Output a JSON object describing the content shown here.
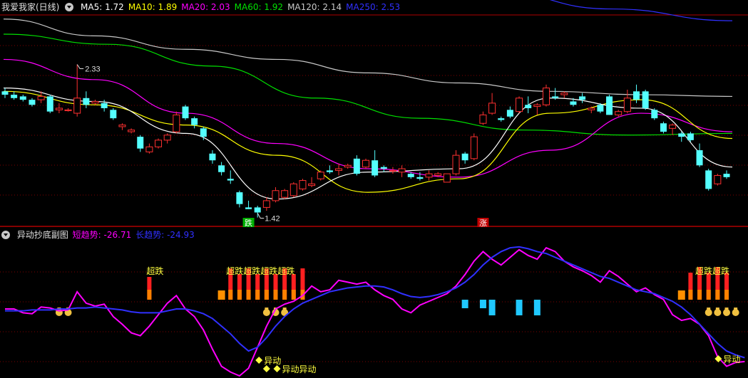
{
  "main_header": {
    "title": "我爱我家(日线)",
    "ma": [
      {
        "label": "MA5: 1.72",
        "color": "#ffffff"
      },
      {
        "label": "MA10: 1.89",
        "color": "#ffff00"
      },
      {
        "label": "MA20: 2.03",
        "color": "#ff00ff"
      },
      {
        "label": "MA60: 1.92",
        "color": "#00e000"
      },
      {
        "label": "MA120: 2.14",
        "color": "#c8c8c8"
      },
      {
        "label": "MA250: 2.53",
        "color": "#3030ff"
      }
    ]
  },
  "sub_header": {
    "title": "异动抄底副图",
    "items": [
      {
        "label": "短趋势: -26.71",
        "color": "#ff00ff"
      },
      {
        "label": "长趋势: -24.93",
        "color": "#3030ff"
      }
    ]
  },
  "chart_data": [
    {
      "type": "candlestick",
      "title": "我爱我家(日线)",
      "annotations": [
        {
          "text": "2.33",
          "kind": "high-marker"
        },
        {
          "text": "1.42",
          "kind": "low-marker"
        },
        {
          "text": "跌",
          "kind": "down-tag",
          "color": "#00b000"
        },
        {
          "text": "涨",
          "kind": "up-tag",
          "color": "#c00000"
        }
      ],
      "colors": {
        "up": "#ff3030",
        "down": "#54ffff",
        "grid": "#800000"
      },
      "ohlc": [
        [
          2.17,
          2.19,
          2.13,
          2.15
        ],
        [
          2.15,
          2.17,
          2.12,
          2.13
        ],
        [
          2.14,
          2.15,
          2.11,
          2.12
        ],
        [
          2.12,
          2.13,
          2.08,
          2.09
        ],
        [
          2.12,
          2.17,
          2.1,
          2.14
        ],
        [
          2.14,
          2.15,
          2.04,
          2.05
        ],
        [
          2.06,
          2.1,
          2.04,
          2.07
        ],
        [
          2.06,
          2.07,
          2.05,
          2.06
        ],
        [
          2.04,
          2.33,
          2.02,
          2.13
        ],
        [
          2.13,
          2.17,
          2.07,
          2.09
        ],
        [
          2.1,
          2.12,
          2.09,
          2.11
        ],
        [
          2.1,
          2.12,
          2.05,
          2.07
        ],
        [
          2.06,
          2.07,
          2.0,
          2.01
        ],
        [
          1.96,
          1.98,
          1.94,
          1.97
        ],
        [
          1.93,
          1.95,
          1.92,
          1.94
        ],
        [
          1.9,
          1.91,
          1.81,
          1.83
        ],
        [
          1.81,
          1.86,
          1.8,
          1.84
        ],
        [
          1.84,
          1.89,
          1.83,
          1.88
        ],
        [
          1.88,
          1.92,
          1.86,
          1.91
        ],
        [
          1.93,
          2.05,
          1.92,
          2.03
        ],
        [
          2.08,
          2.09,
          2.0,
          2.01
        ],
        [
          2.01,
          2.02,
          1.95,
          1.97
        ],
        [
          1.95,
          1.96,
          1.88,
          1.9
        ],
        [
          1.8,
          1.82,
          1.74,
          1.76
        ],
        [
          1.73,
          1.75,
          1.67,
          1.69
        ],
        [
          1.65,
          1.7,
          1.62,
          1.64
        ],
        [
          1.57,
          1.58,
          1.48,
          1.5
        ],
        [
          1.48,
          1.52,
          1.47,
          1.47
        ],
        [
          1.48,
          1.49,
          1.42,
          1.45
        ],
        [
          1.48,
          1.54,
          1.46,
          1.52
        ],
        [
          1.52,
          1.6,
          1.51,
          1.58
        ],
        [
          1.54,
          1.59,
          1.53,
          1.58
        ],
        [
          1.55,
          1.63,
          1.54,
          1.62
        ],
        [
          1.59,
          1.65,
          1.58,
          1.64
        ],
        [
          1.61,
          1.66,
          1.6,
          1.62
        ],
        [
          1.65,
          1.7,
          1.64,
          1.69
        ],
        [
          1.7,
          1.73,
          1.68,
          1.69
        ],
        [
          1.7,
          1.74,
          1.67,
          1.71
        ],
        [
          1.72,
          1.74,
          1.71,
          1.73
        ],
        [
          1.77,
          1.79,
          1.67,
          1.68
        ],
        [
          1.72,
          1.77,
          1.71,
          1.76
        ],
        [
          1.76,
          1.82,
          1.66,
          1.67
        ],
        [
          1.72,
          1.73,
          1.69,
          1.71
        ],
        [
          1.7,
          1.72,
          1.68,
          1.7
        ],
        [
          1.69,
          1.73,
          1.66,
          1.71
        ],
        [
          1.68,
          1.69,
          1.65,
          1.66
        ],
        [
          1.66,
          1.69,
          1.64,
          1.65
        ],
        [
          1.66,
          1.7,
          1.64,
          1.68
        ],
        [
          1.67,
          1.69,
          1.66,
          1.68
        ],
        [
          1.63,
          1.68,
          1.63,
          1.68
        ],
        [
          1.68,
          1.82,
          1.67,
          1.79
        ],
        [
          1.8,
          1.81,
          1.74,
          1.76
        ],
        [
          1.77,
          1.92,
          1.76,
          1.9
        ],
        [
          1.98,
          2.05,
          1.97,
          2.03
        ],
        [
          2.04,
          2.16,
          2.03,
          2.1
        ],
        [
          2.01,
          2.02,
          1.99,
          2.0
        ],
        [
          2.06,
          2.08,
          2.01,
          2.02
        ],
        [
          2.05,
          2.14,
          2.04,
          2.13
        ],
        [
          2.09,
          2.14,
          2.04,
          2.07
        ],
        [
          2.08,
          2.1,
          2.03,
          2.09
        ],
        [
          2.09,
          2.21,
          2.08,
          2.19
        ],
        [
          2.14,
          2.19,
          2.12,
          2.13
        ],
        [
          2.15,
          2.17,
          2.13,
          2.16
        ],
        [
          2.11,
          2.13,
          2.08,
          2.09
        ],
        [
          2.14,
          2.16,
          2.1,
          2.12
        ],
        [
          2.06,
          2.08,
          2.04,
          2.07
        ],
        [
          2.09,
          2.1,
          2.04,
          2.05
        ],
        [
          2.14,
          2.15,
          2.03,
          2.03
        ],
        [
          2.03,
          2.06,
          2.02,
          2.05
        ],
        [
          2.05,
          2.18,
          2.04,
          2.13
        ],
        [
          2.17,
          2.21,
          2.1,
          2.12
        ],
        [
          2.17,
          2.18,
          2.06,
          2.07
        ],
        [
          2.06,
          2.07,
          2.0,
          2.01
        ],
        [
          1.98,
          1.99,
          1.92,
          1.93
        ],
        [
          1.95,
          1.98,
          1.91,
          1.97
        ],
        [
          1.92,
          1.93,
          1.87,
          1.9
        ],
        [
          1.92,
          1.93,
          1.87,
          1.88
        ],
        [
          1.82,
          1.86,
          1.72,
          1.73
        ],
        [
          1.7,
          1.71,
          1.58,
          1.59
        ],
        [
          1.62,
          1.68,
          1.61,
          1.67
        ],
        [
          1.68,
          1.7,
          1.65,
          1.66
        ]
      ],
      "ma_series": [
        {
          "name": "MA250",
          "color": "#3030ff",
          "values": [
            3.19,
            3.1,
            2.99,
            2.88,
            2.77,
            2.66,
            2.59
          ]
        },
        {
          "name": "MA120",
          "color": "#c8c8c8",
          "values": [
            2.6,
            2.5,
            2.42,
            2.36,
            2.28,
            2.22,
            2.17,
            2.15,
            2.14
          ]
        },
        {
          "name": "MA60",
          "color": "#00e000",
          "values": [
            2.51,
            2.45,
            2.32,
            2.13,
            2.01,
            1.94,
            1.91,
            1.92
          ]
        },
        {
          "name": "MA20",
          "color": "#ff00ff",
          "values": [
            2.36,
            2.24,
            2.04,
            1.86,
            1.71,
            1.66,
            1.82,
            2.04,
            1.93
          ]
        },
        {
          "name": "MA10",
          "color": "#ffff00",
          "values": [
            2.17,
            2.09,
            1.97,
            1.79,
            1.57,
            1.65,
            2.04,
            2.12,
            1.89
          ]
        },
        {
          "name": "MA5",
          "color": "#ffffff",
          "values": [
            2.19,
            2.11,
            1.92,
            1.53,
            1.69,
            1.71,
            2.13,
            2.07,
            1.72
          ]
        }
      ]
    },
    {
      "type": "line",
      "title": "异动抄底副图",
      "ylim": [
        -40,
        100
      ],
      "series": [
        {
          "name": "短趋势",
          "color": "#ff00ff",
          "values": [
            30,
            30,
            26,
            25,
            32,
            31,
            28,
            29,
            48,
            36,
            33,
            35,
            22,
            14,
            5,
            2,
            12,
            24,
            36,
            44,
            30,
            22,
            8,
            -12,
            -30,
            -36,
            -40,
            -32,
            -10,
            12,
            30,
            35,
            38,
            44,
            54,
            48,
            50,
            60,
            58,
            56,
            58,
            50,
            44,
            40,
            30,
            26,
            34,
            38,
            42,
            46,
            54,
            66,
            80,
            90,
            82,
            76,
            84,
            92,
            86,
            82,
            94,
            90,
            80,
            74,
            70,
            65,
            58,
            70,
            64,
            56,
            48,
            52,
            45,
            40,
            24,
            18,
            20,
            14,
            2,
            -20,
            -30,
            -26,
            -25
          ]
        },
        {
          "name": "长趋势",
          "color": "#3030ff",
          "values": [
            28,
            28,
            28,
            29,
            29,
            29,
            30,
            30,
            31,
            31,
            32,
            31,
            30,
            29,
            27,
            26,
            26,
            26,
            28,
            30,
            30,
            28,
            25,
            20,
            12,
            4,
            -6,
            -14,
            -10,
            0,
            12,
            22,
            30,
            36,
            40,
            44,
            48,
            50,
            52,
            53,
            54,
            54,
            53,
            50,
            46,
            43,
            42,
            43,
            45,
            48,
            52,
            58,
            66,
            76,
            84,
            90,
            94,
            95,
            93,
            90,
            88,
            84,
            80,
            76,
            72,
            68,
            64,
            62,
            58,
            54,
            50,
            48,
            46,
            42,
            38,
            32,
            24,
            14,
            4,
            -6,
            -14,
            -18,
            -21
          ]
        }
      ],
      "labels": [
        "超跌",
        "超跌超跌超跌超跌",
        "超跌超跌",
        "异动",
        "异动异动",
        "异动"
      ]
    }
  ]
}
